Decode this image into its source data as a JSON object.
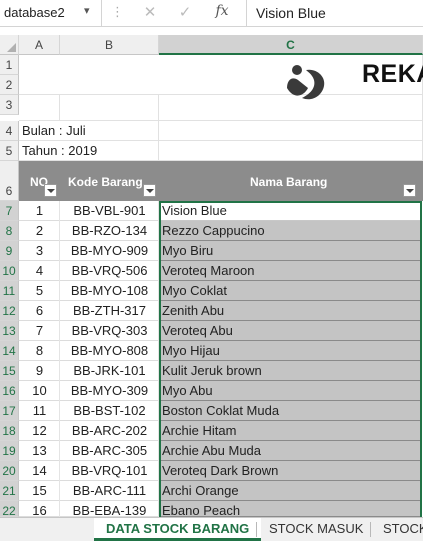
{
  "formula_bar": {
    "name_box": "database2",
    "name_box_dropdown": "▾",
    "dots": "⋮",
    "cancel_symbol": "✕",
    "enter_symbol": "✓",
    "fx_label": "fx",
    "formula_value": "Vision Blue"
  },
  "columns": [
    "A",
    "B",
    "C"
  ],
  "row_numbers": [
    "1",
    "2",
    "3",
    "4",
    "5",
    "6",
    "7",
    "8",
    "9",
    "10",
    "11",
    "12",
    "13",
    "14",
    "15",
    "16",
    "17",
    "18",
    "19",
    "20",
    "21",
    "22"
  ],
  "title": "REKA",
  "info": {
    "bulan": "Bulan : Juli",
    "tahun": "Tahun : 2019"
  },
  "table": {
    "headers": {
      "no": "NO",
      "kode": "Kode  Barang",
      "nama": "Nama Barang"
    },
    "rows": [
      {
        "no": "1",
        "kode": "BB-VBL-901",
        "nama": "Vision Blue"
      },
      {
        "no": "2",
        "kode": "BB-RZO-134",
        "nama": "Rezzo Cappucino"
      },
      {
        "no": "3",
        "kode": "BB-MYO-909",
        "nama": "Myo Biru"
      },
      {
        "no": "4",
        "kode": "BB-VRQ-506",
        "nama": "Veroteq Maroon"
      },
      {
        "no": "5",
        "kode": "BB-MYO-108",
        "nama": "Myo Coklat"
      },
      {
        "no": "6",
        "kode": "BB-ZTH-317",
        "nama": "Zenith Abu"
      },
      {
        "no": "7",
        "kode": "BB-VRQ-303",
        "nama": "Veroteq Abu"
      },
      {
        "no": "8",
        "kode": "BB-MYO-808",
        "nama": "Myo Hijau"
      },
      {
        "no": "9",
        "kode": "BB-JRK-101",
        "nama": "Kulit Jeruk brown"
      },
      {
        "no": "10",
        "kode": "BB-MYO-309",
        "nama": "Myo Abu"
      },
      {
        "no": "11",
        "kode": "BB-BST-102",
        "nama": "Boston Coklat Muda"
      },
      {
        "no": "12",
        "kode": "BB-ARC-202",
        "nama": "Archie Hitam"
      },
      {
        "no": "13",
        "kode": "BB-ARC-305",
        "nama": "Archie Abu Muda"
      },
      {
        "no": "14",
        "kode": "BB-VRQ-101",
        "nama": "Veroteq Dark Brown"
      },
      {
        "no": "15",
        "kode": "BB-ARC-111",
        "nama": "Archi Orange"
      },
      {
        "no": "16",
        "kode": "BB-EBA-139",
        "nama": "Ebano Peach"
      }
    ]
  },
  "sheet_tabs": [
    "DATA STOCK BARANG",
    "STOCK MASUK",
    "STOCK"
  ],
  "colors": {
    "accent": "#217346",
    "header_bg": "#8c8c8c",
    "selected_fill": "#c4c4c4"
  },
  "icons": {
    "logo": "company-logo-icon",
    "filter": "filter-dropdown-icon"
  }
}
